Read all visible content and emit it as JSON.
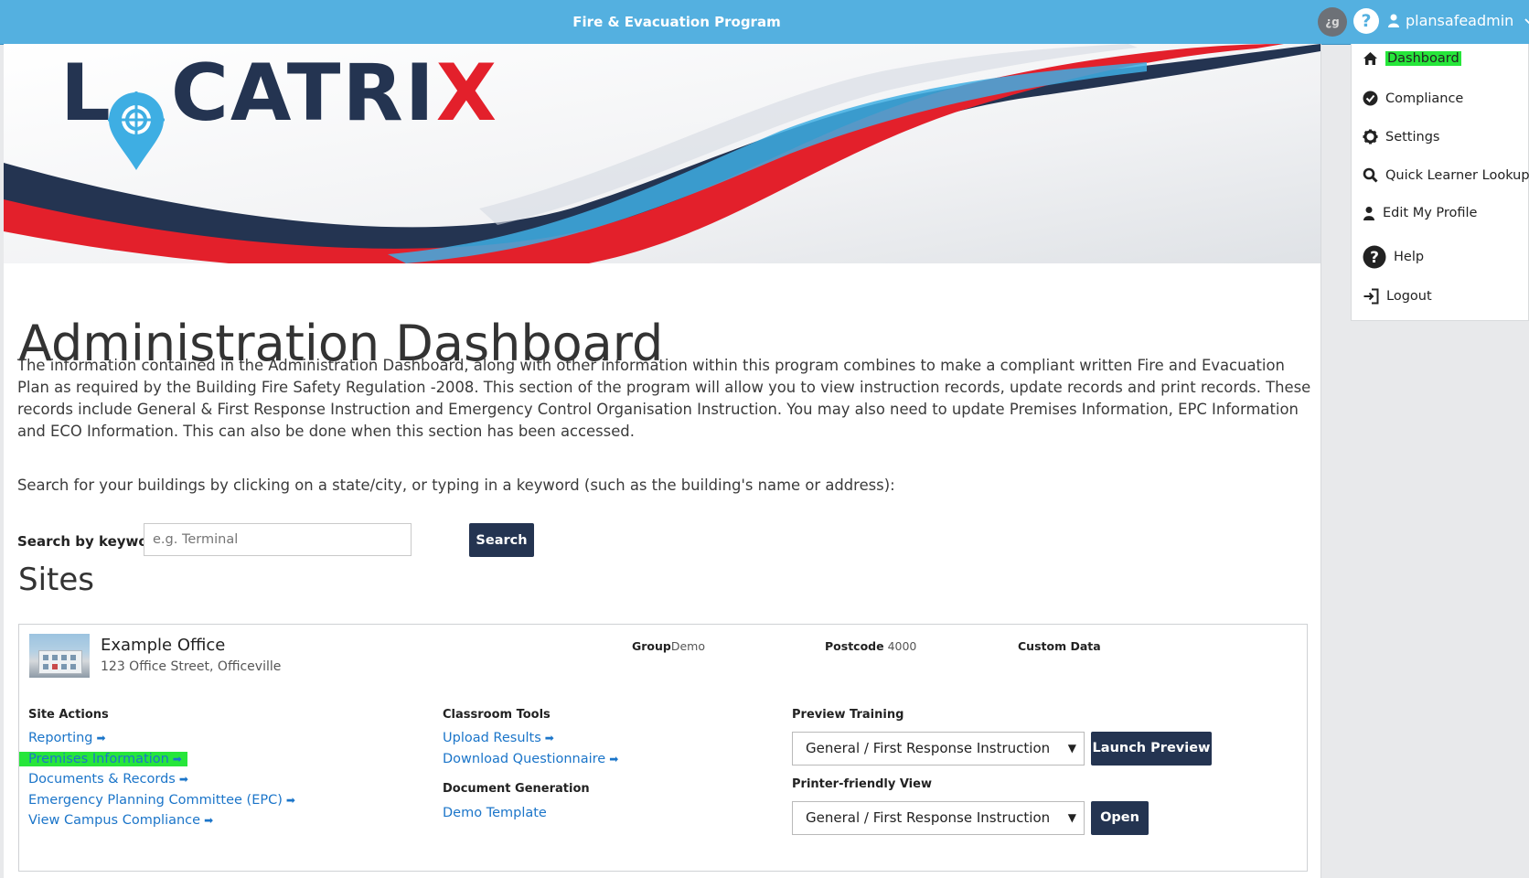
{
  "topbar": {
    "title": "Fire & Evacuation Program",
    "avatar_text": "¿g",
    "help_icon": "?",
    "username": "plansafeadmin"
  },
  "brand": {
    "logo_text": "LOCATRIX",
    "colors": {
      "navy": "#243451",
      "red": "#e3202b",
      "blue": "#3eaee3",
      "topbar": "#54b0e0",
      "highlight": "#26e63a",
      "link": "#1b75c9"
    }
  },
  "page": {
    "title": "Administration Dashboard",
    "intro": "The information contained in the Administration Dashboard, along with other information within this program combines to make a compliant written Fire and Evacuation Plan as required by the Building Fire Safety Regulation -2008. This section of the program will allow you to view instruction records, update records and print records. These records include General & First Response Instruction and Emergency Control Organisation Instruction. You may also need to update Premises Information, EPC Information and ECO Information. This can also be done when this section has been accessed.",
    "search_hint": "Search for your buildings by clicking on a state/city, or typing in a keyword (such as the building's name or address):",
    "search": {
      "label": "Search by keyword",
      "placeholder": "e.g. Terminal",
      "button": "Search"
    },
    "sites_heading": "Sites"
  },
  "site": {
    "name": "Example Office",
    "address": "123 Office Street, Officeville",
    "group_label": "Group",
    "group_value": "Demo",
    "postcode_label": "Postcode",
    "postcode_value": "4000",
    "custom_data_label": "Custom Data",
    "site_actions": {
      "heading": "Site Actions",
      "links": [
        "Reporting",
        "Premises Information",
        "Documents & Records",
        "Emergency Planning Committee (EPC)",
        "View Campus Compliance"
      ]
    },
    "classroom_tools": {
      "heading": "Classroom Tools",
      "links": [
        "Upload Results",
        "Download Questionnaire"
      ]
    },
    "document_generation": {
      "heading": "Document Generation",
      "links": [
        "Demo Template"
      ]
    },
    "preview_training": {
      "heading": "Preview Training",
      "selected": "General / First Response Instruction",
      "button": "Launch Preview"
    },
    "printer_friendly": {
      "heading": "Printer-friendly View",
      "selected": "General / First Response Instruction",
      "button": "Open"
    }
  },
  "menu": {
    "items": [
      {
        "label": "Dashboard",
        "icon": "home-icon",
        "active": true
      },
      {
        "label": "Compliance",
        "icon": "check-circle-icon"
      },
      {
        "label": "Settings",
        "icon": "gear-icon"
      },
      {
        "label": "Quick Learner Lookup",
        "icon": "search-icon"
      },
      {
        "label": "Edit My Profile",
        "icon": "user-icon"
      },
      {
        "label": "Help",
        "icon": "help-circle-icon"
      },
      {
        "label": "Logout",
        "icon": "logout-icon"
      }
    ]
  }
}
